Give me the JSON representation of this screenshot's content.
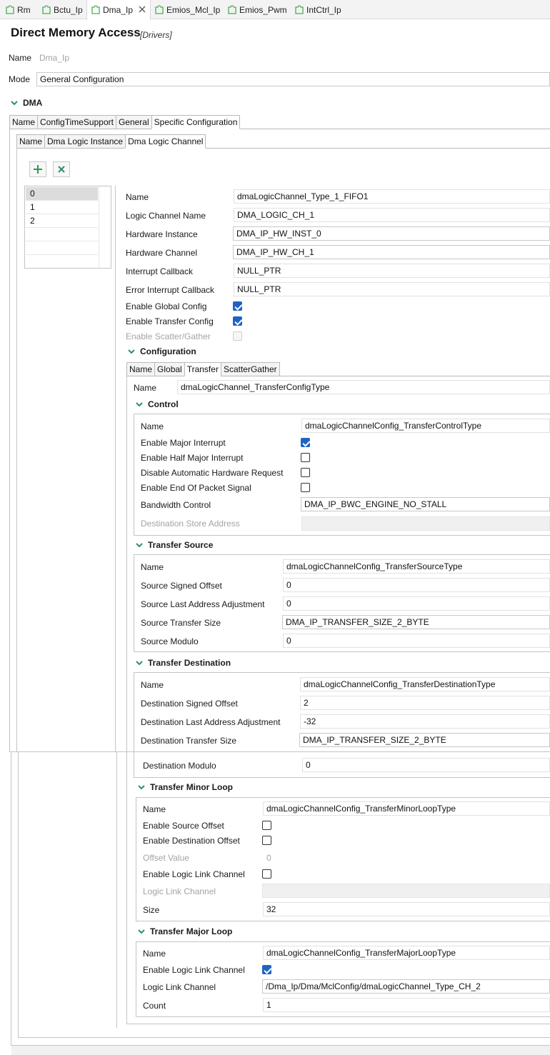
{
  "editor_tabs": [
    {
      "label": "Rm"
    },
    {
      "label": "Bctu_Ip"
    },
    {
      "label": "Dma_Ip"
    },
    {
      "label": "Emios_Mcl_Ip"
    },
    {
      "label": "Emios_Pwm"
    },
    {
      "label": "IntCtrl_Ip"
    }
  ],
  "header": {
    "title": "Direct Memory Access",
    "subtitle": "[Drivers]"
  },
  "module": {
    "name_label": "Name",
    "name_value": "Dma_Ip",
    "mode_label": "Mode",
    "mode_value": "General Configuration"
  },
  "dma_section": {
    "title": "DMA"
  },
  "outer_tabs": [
    "Name",
    "ConfigTimeSupport",
    "General",
    "Specific Configuration"
  ],
  "inner_tabs": [
    "Name",
    "Dma Logic Instance",
    "Dma Logic Channel"
  ],
  "channel_list": [
    "0",
    "1",
    "2"
  ],
  "channel": {
    "fields": [
      {
        "label": "Name",
        "value": "dmaLogicChannel_Type_1_FIFO1"
      },
      {
        "label": "Logic Channel Name",
        "value": "DMA_LOGIC_CH_1"
      },
      {
        "label": "Hardware Instance",
        "value": "DMA_IP_HW_INST_0"
      },
      {
        "label": "Hardware Channel",
        "value": "DMA_IP_HW_CH_1"
      },
      {
        "label": "Interrupt Callback",
        "value": "NULL_PTR"
      },
      {
        "label": "Error Interrupt Callback",
        "value": "NULL_PTR"
      }
    ],
    "checks": [
      {
        "label": "Enable Global Config",
        "checked": true
      },
      {
        "label": "Enable Transfer Config",
        "checked": true
      },
      {
        "label": "Enable Scatter/Gather",
        "checked": false
      }
    ]
  },
  "configuration": {
    "title": "Configuration",
    "tabs": [
      "Name",
      "Global",
      "Transfer",
      "ScatterGather"
    ],
    "name_label": "Name",
    "name_value": "dmaLogicChannel_TransferConfigType"
  },
  "control": {
    "title": "Control",
    "name_label": "Name",
    "name_value": "dmaLogicChannelConfig_TransferControlType",
    "checks": [
      {
        "label": "Enable Major Interrupt",
        "checked": true
      },
      {
        "label": "Enable Half Major Interrupt",
        "checked": false
      },
      {
        "label": "Disable Automatic Hardware Request",
        "checked": false
      },
      {
        "label": "Enable End Of Packet Signal",
        "checked": false
      }
    ],
    "bandwidth_label": "Bandwidth Control",
    "bandwidth_value": "DMA_IP_BWC_ENGINE_NO_STALL",
    "dest_store_label": "Destination Store Address",
    "dest_store_value": ""
  },
  "transfer_source": {
    "title": "Transfer Source",
    "fields": [
      {
        "label": "Name",
        "value": "dmaLogicChannelConfig_TransferSourceType"
      },
      {
        "label": "Source Signed Offset",
        "value": "0"
      },
      {
        "label": "Source Last Address Adjustment",
        "value": "0"
      },
      {
        "label": "Source Transfer Size",
        "value": "DMA_IP_TRANSFER_SIZE_2_BYTE"
      },
      {
        "label": "Source Modulo",
        "value": "0"
      }
    ]
  },
  "transfer_destination": {
    "title": "Transfer Destination",
    "fields": [
      {
        "label": "Name",
        "value": "dmaLogicChannelConfig_TransferDestinationType"
      },
      {
        "label": "Destination Signed Offset",
        "value": "2"
      },
      {
        "label": "Destination Last Address Adjustment",
        "value": "-32"
      },
      {
        "label": "Destination Transfer Size",
        "value": "DMA_IP_TRANSFER_SIZE_2_BYTE"
      },
      {
        "label": "Destination Modulo",
        "value": "0"
      }
    ]
  },
  "minor_loop": {
    "title": "Transfer Minor Loop",
    "name_label": "Name",
    "name_value": "dmaLogicChannelConfig_TransferMinorLoopType",
    "src_offset_label": "Enable Source Offset",
    "src_offset_checked": false,
    "dst_offset_label": "Enable Destination Offset",
    "dst_offset_checked": false,
    "offset_value_label": "Offset Value",
    "offset_value": "0",
    "link_enable_label": "Enable Logic Link Channel",
    "link_enable_checked": false,
    "link_channel_label": "Logic Link Channel",
    "link_channel_value": "",
    "size_label": "Size",
    "size_value": "32"
  },
  "major_loop": {
    "title": "Transfer Major Loop",
    "name_label": "Name",
    "name_value": "dmaLogicChannelConfig_TransferMajorLoopType",
    "link_enable_label": "Enable Logic Link Channel",
    "link_enable_checked": true,
    "link_channel_label": "Logic Link Channel",
    "link_channel_value": "/Dma_Ip/Dma/MclConfig/dmaLogicChannel_Type_CH_2",
    "count_label": "Count",
    "count_value": "1"
  },
  "colors": {
    "accent": "#1f64c4",
    "chevron": "#2c8c78",
    "icon_green": "#4caf50"
  }
}
